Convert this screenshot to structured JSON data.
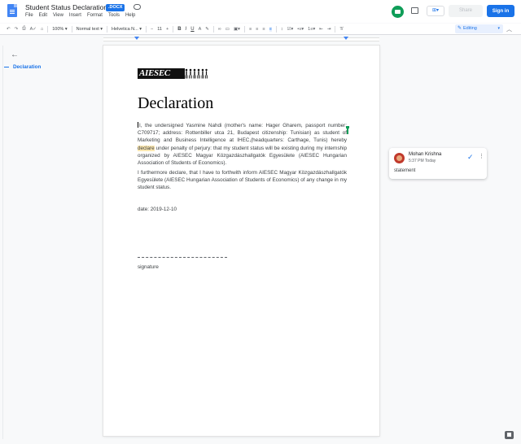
{
  "header": {
    "title": "Student Status Declaration",
    "badge": ".DOCX",
    "menu": [
      "File",
      "Edit",
      "View",
      "Insert",
      "Format",
      "Tools",
      "Help"
    ],
    "share_label": "Share",
    "signin_label": "Sign in"
  },
  "toolbar": {
    "zoom": "100%",
    "style": "Normal text",
    "font": "Helvetica N...",
    "font_size": "11",
    "mode": "Editing",
    "icons": [
      "undo-icon",
      "redo-icon",
      "print-icon",
      "spellcheck-icon",
      "paint-format-icon",
      "bold-icon",
      "italic-icon",
      "underline-icon",
      "text-color-icon",
      "highlight-icon",
      "link-icon",
      "comment-icon",
      "image-icon",
      "align-left-icon",
      "align-center-icon",
      "align-right-icon",
      "justify-icon",
      "line-spacing-icon",
      "checklist-icon",
      "bullets-icon",
      "numbering-icon",
      "indent-decrease-icon",
      "indent-increase-icon",
      "clear-format-icon"
    ]
  },
  "outline": {
    "items": [
      "Declaration"
    ]
  },
  "document": {
    "logo_text": "AIESEC",
    "heading": "Declaration",
    "p1_before": "I, the undersigned Yasmine Nahdi (mother's name: Hager Gharem, passport number: C709717; address: Rottenbiller utca 21, Budapest citizenship: Tunisian) as student of Marketing and Business Intelligence at IHEC,(headquarters: Carthage, Tunis) hereby ",
    "p1_highlight": "declare",
    "p1_after": " under penalty of perjury: that my student status will be existing during my internship organized by AIESEC Magyar Közgazdászhallgatók Egyesülete (AIESEC Hungarian Association of Students of Economics).",
    "p2": "I furthermore declare, that I have to forthwith inform AIESEC Magyar Közgazdászhallgatók Egyesülete (AIESEC Hungarian Association of Students of Economics) of any change in my student status.",
    "date": "date: 2019-12-10",
    "signature_label": "signature"
  },
  "comment": {
    "author": "Mohan Krishna",
    "time": "5:37 PM Today",
    "text": "statement"
  },
  "colors": {
    "accent": "#1a73e8",
    "highlight": "#fce8b2",
    "collaborator": "#0f9d58"
  }
}
